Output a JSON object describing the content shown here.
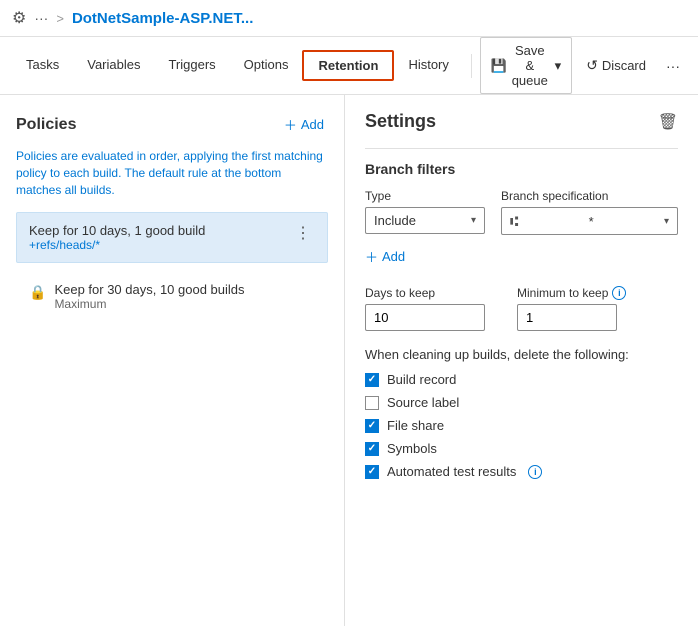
{
  "header": {
    "icon": "⚙",
    "dots": "···",
    "separator": ">",
    "title": "DotNetSample-ASP.NET..."
  },
  "nav": {
    "tabs": [
      {
        "label": "Tasks",
        "active": false,
        "outlined": false
      },
      {
        "label": "Variables",
        "active": false,
        "outlined": false
      },
      {
        "label": "Triggers",
        "active": false,
        "outlined": false
      },
      {
        "label": "Options",
        "active": false,
        "outlined": false
      },
      {
        "label": "Retention",
        "active": true,
        "outlined": true
      },
      {
        "label": "History",
        "active": false,
        "outlined": false
      }
    ],
    "save_label": "Save & queue",
    "discard_label": "Discard",
    "more": "···"
  },
  "left_panel": {
    "title": "Policies",
    "add_label": "+ Add",
    "description": "Policies are evaluated in order, applying the first matching policy to each build. The default rule at the bottom matches all builds.",
    "policies": [
      {
        "name": "Keep for 10 days, 1 good build",
        "sub": "+refs/heads/*",
        "selected": true
      }
    ],
    "max_policy": {
      "name": "Keep for 30 days, 10 good builds",
      "sub": "Maximum"
    }
  },
  "right_panel": {
    "title": "Settings",
    "section_branch": "Branch filters",
    "type_label": "Type",
    "type_value": "Include",
    "branch_label": "Branch specification",
    "branch_value": "* *",
    "branch_icon": "⑆",
    "add_filter_label": "+ Add",
    "days_label": "Days to keep",
    "days_value": "10",
    "min_label": "Minimum to keep",
    "min_value": "1",
    "delete_label": "When cleaning up builds, delete the following:",
    "checkboxes": [
      {
        "label": "Build record",
        "checked": true
      },
      {
        "label": "Source label",
        "checked": false
      },
      {
        "label": "File share",
        "checked": true
      },
      {
        "label": "Symbols",
        "checked": true
      },
      {
        "label": "Automated test results",
        "checked": true,
        "info": true
      }
    ]
  }
}
